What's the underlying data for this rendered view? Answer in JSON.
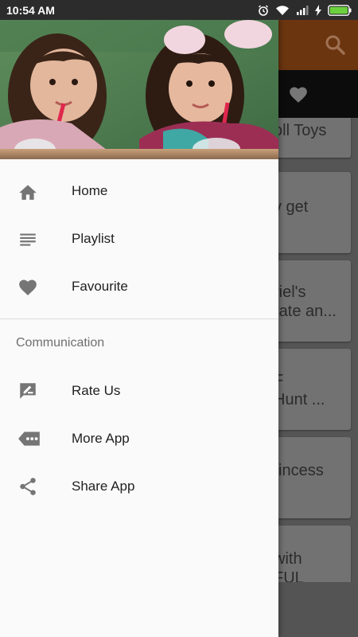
{
  "status_bar": {
    "time": "10:54 AM",
    "icons": [
      "alarm-icon",
      "wifi-icon",
      "signal-icon",
      "charging-icon",
      "battery-icon"
    ]
  },
  "background_app": {
    "toolbar_color": "#6b3510",
    "cards": [
      {
        "text": "oll Toys"
      },
      {
        "text": "y get"
      },
      {
        "text": "riel's\nrate an..."
      },
      {
        "text": "F\nHunt ..."
      },
      {
        "text": "Princess"
      },
      {
        "text": "with\nFUL"
      }
    ]
  },
  "drawer": {
    "header_image": "girls-drinking-through-straws-photo",
    "menu": [
      {
        "label": "Home",
        "icon": "home-icon"
      },
      {
        "label": "Playlist",
        "icon": "playlist-icon"
      },
      {
        "label": "Favourite",
        "icon": "heart-icon"
      }
    ],
    "section_title": "Communication",
    "communication": [
      {
        "label": "Rate Us",
        "icon": "rate-feedback-icon"
      },
      {
        "label": "More App",
        "icon": "more-label-icon"
      },
      {
        "label": "Share App",
        "icon": "share-icon"
      }
    ]
  }
}
